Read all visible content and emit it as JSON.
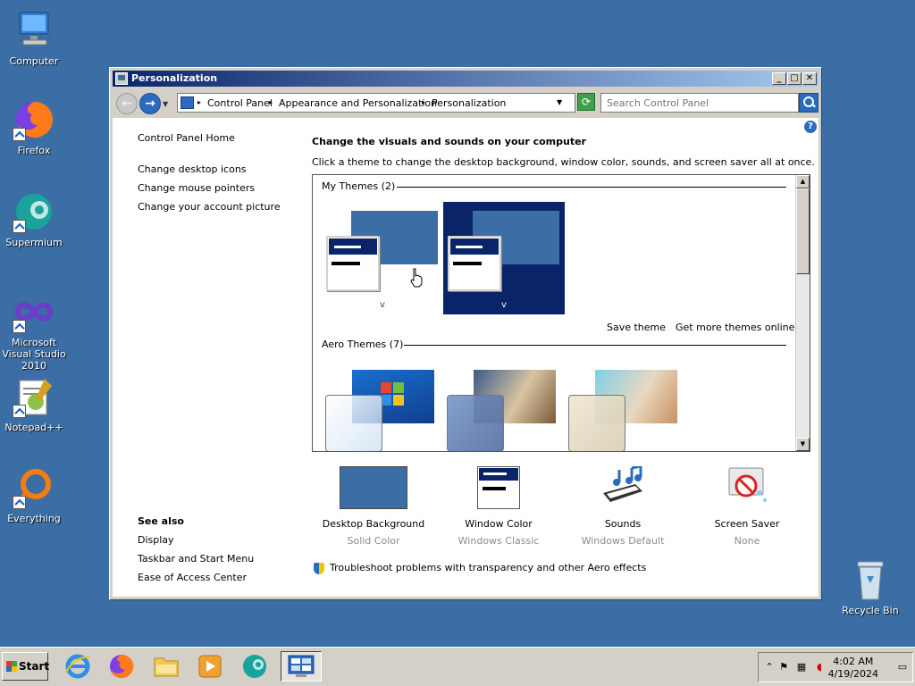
{
  "desktop": {
    "icons": [
      {
        "label": "Computer"
      },
      {
        "label": "Firefox"
      },
      {
        "label": "Supermium"
      },
      {
        "label": "Microsoft Visual Studio 2010"
      },
      {
        "label": "Notepad++"
      },
      {
        "label": "Everything"
      },
      {
        "label": "Recycle Bin"
      }
    ]
  },
  "window": {
    "title": "Personalization",
    "controls": {
      "minimize": "_",
      "maximize": "□",
      "close": "✕"
    },
    "nav": {
      "back": "←",
      "forward": "→",
      "dropdown": "▼"
    },
    "breadcrumb": [
      "Control Panel",
      "Appearance and Personalization",
      "Personalization"
    ],
    "breadcrumb_sep": "▸",
    "search_placeholder": "Search Control Panel",
    "refresh": "⟳"
  },
  "sidebar": {
    "home": "Control Panel Home",
    "links": [
      "Change desktop icons",
      "Change mouse pointers",
      "Change your account picture"
    ],
    "see_also_title": "See also",
    "see_also": [
      "Display",
      "Taskbar and Start Menu",
      "Ease of Access Center"
    ]
  },
  "main": {
    "help": "?",
    "title": "Change the visuals and sounds on your computer",
    "subtitle": "Click a theme to change the desktop background, window color, sounds, and screen saver all at once.",
    "my_themes_header": "My Themes (2)",
    "my_themes": [
      {
        "caption": "v",
        "selected": false
      },
      {
        "caption": "v",
        "selected": true
      }
    ],
    "save_theme": "Save theme",
    "get_more": "Get more themes online",
    "aero_header": "Aero Themes (7)"
  },
  "settings": [
    {
      "name": "Desktop Background",
      "value": "Solid Color"
    },
    {
      "name": "Window Color",
      "value": "Windows Classic"
    },
    {
      "name": "Sounds",
      "value": "Windows Default"
    },
    {
      "name": "Screen Saver",
      "value": "None"
    }
  ],
  "troubleshoot": "Troubleshoot problems with transparency and other Aero effects",
  "taskbar": {
    "start": "Start",
    "time": "4:02 AM",
    "date": "4/19/2024"
  },
  "colors": {
    "desktop": "#3a6ea5",
    "selection": "#0a246a",
    "title_start": "#0a246a",
    "title_end": "#a6caf0"
  }
}
